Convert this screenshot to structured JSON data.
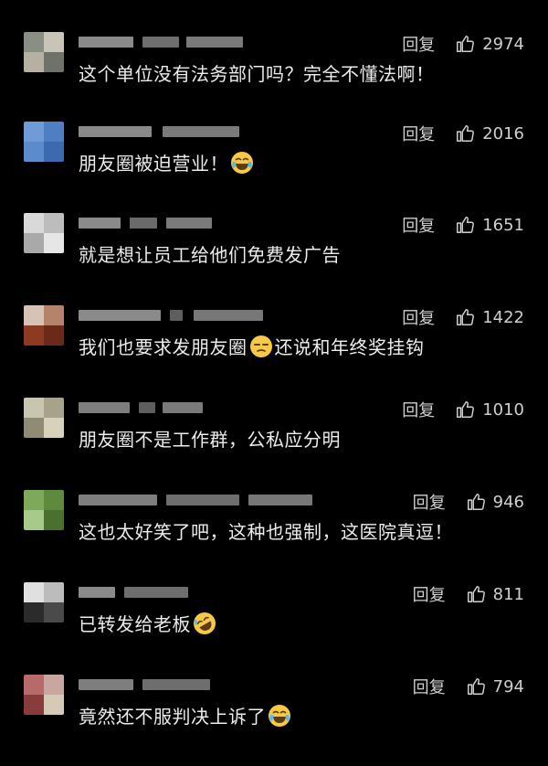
{
  "comments": [
    {
      "text_before": "这个单位没有法务部门吗？完全不懂法啊！",
      "emoji": "",
      "text_after": "",
      "reply": "回复",
      "likes": "2974"
    },
    {
      "text_before": "朋友圈被迫营业！",
      "emoji": "tears-of-joy-emoji",
      "text_after": "",
      "reply": "回复",
      "likes": "2016"
    },
    {
      "text_before": "就是想让员工给他们免费发广告",
      "emoji": "",
      "text_after": "",
      "reply": "回复",
      "likes": "1651"
    },
    {
      "text_before": "我们也要求发朋友圈",
      "emoji": "unamused-emoji",
      "text_after": "还说和年终奖挂钩",
      "reply": "回复",
      "likes": "1422"
    },
    {
      "text_before": "朋友圈不是工作群，公私应分明",
      "emoji": "",
      "text_after": "",
      "reply": "回复",
      "likes": "1010"
    },
    {
      "text_before": "这也太好笑了吧，这种也强制，这医院真逗！",
      "emoji": "",
      "text_after": "",
      "reply": "回复",
      "likes": "946"
    },
    {
      "text_before": "已转发给老板",
      "emoji": "rolling-laughing-emoji",
      "text_after": "",
      "reply": "回复",
      "likes": "811"
    },
    {
      "text_before": "竟然还不服判决上诉了",
      "emoji": "tears-of-joy-emoji",
      "text_after": "",
      "reply": "回复",
      "likes": "794"
    }
  ],
  "colors": {
    "background": "#000000",
    "text": "#ececec",
    "meta": "#cfcfcf",
    "emoji_face": "#f7c948"
  }
}
